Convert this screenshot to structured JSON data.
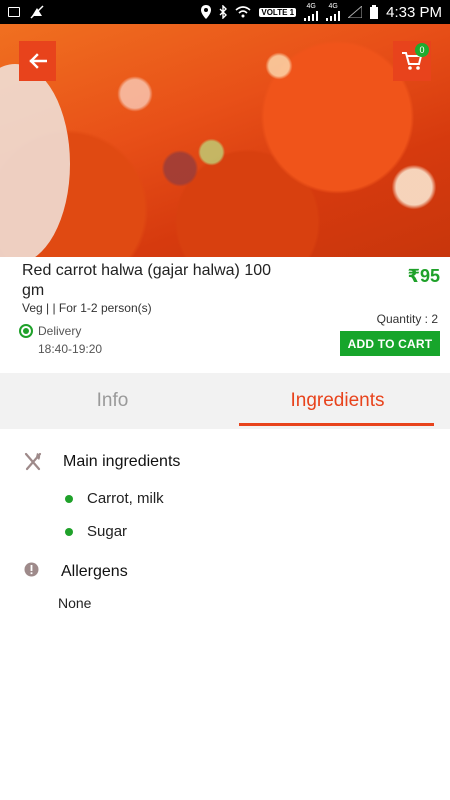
{
  "status_bar": {
    "network_label": "VOLTE 1",
    "signal_label_1": "4G",
    "signal_label_2": "4G",
    "time": "4:33 PM"
  },
  "header": {
    "cart_count": "0"
  },
  "product": {
    "title": "Red carrot halwa (gajar halwa) 100 gm",
    "price": "₹95",
    "veg_info": "Veg | | For 1-2 person(s)",
    "delivery_label": "Delivery",
    "delivery_time": "18:40-19:20",
    "quantity": "Quantity : 2",
    "add_to_cart": "ADD TO CART"
  },
  "tabs": [
    {
      "label": "Info",
      "active": false
    },
    {
      "label": "Ingredients",
      "active": true
    }
  ],
  "ingredients": {
    "heading": "Main ingredients",
    "items": [
      "Carrot, milk",
      "Sugar"
    ]
  },
  "allergens": {
    "heading": "Allergens",
    "value": "None"
  },
  "colors": {
    "accent": "#e8431c",
    "green": "#1fa12a"
  },
  "icons": {
    "back": "arrow-left-icon",
    "cart": "cart-icon",
    "ingredients": "fork-knife-icon",
    "allergens": "alert-icon"
  }
}
